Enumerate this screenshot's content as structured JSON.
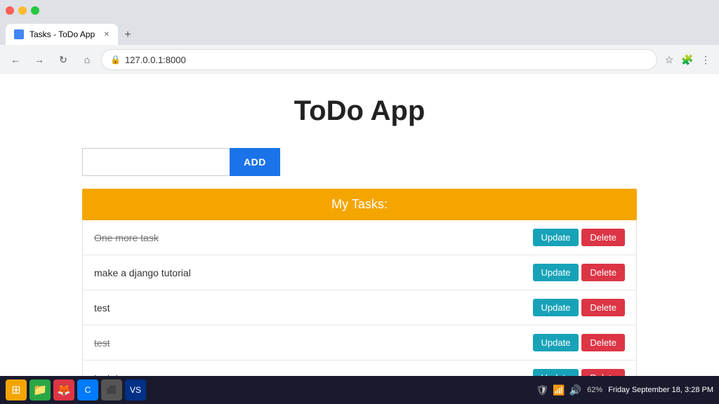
{
  "browser": {
    "tab_title": "Tasks - ToDo App",
    "address": "127.0.0.1:8000",
    "new_tab_label": "+",
    "back_label": "←",
    "forward_label": "→",
    "refresh_label": "↻",
    "home_label": "⌂"
  },
  "app": {
    "title": "ToDo App",
    "input_placeholder": "",
    "add_button_label": "ADD",
    "tasks_header": "My Tasks:",
    "tasks": [
      {
        "id": 1,
        "text": "One more task",
        "strikethrough": true
      },
      {
        "id": 2,
        "text": "make a django tutorial",
        "strikethrough": false
      },
      {
        "id": 3,
        "text": "test",
        "strikethrough": false
      },
      {
        "id": 4,
        "text": "test",
        "strikethrough": true
      },
      {
        "id": 5,
        "text": "testete",
        "strikethrough": false
      }
    ],
    "update_label": "Update",
    "delete_label": "Delete"
  },
  "taskbar": {
    "battery": "62%",
    "datetime": "Friday September 18, 3:28 PM"
  },
  "colors": {
    "add_button": "#1a73e8",
    "tasks_header_bg": "#f5a500",
    "update_btn": "#17a2b8",
    "delete_btn": "#dc3545"
  }
}
